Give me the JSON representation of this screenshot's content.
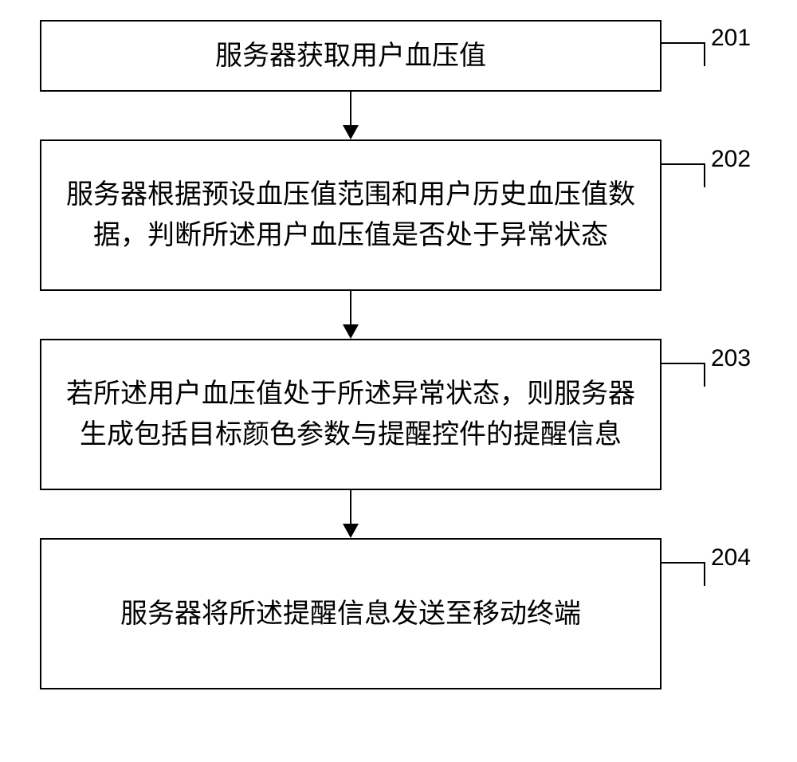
{
  "chart_data": {
    "type": "flowchart",
    "steps": [
      {
        "id": "201",
        "text": "服务器获取用户血压值",
        "size": "small"
      },
      {
        "id": "202",
        "text": "服务器根据预设血压值范围和用户历史血压值数据，判断所述用户血压值是否处于异常状态",
        "size": "large"
      },
      {
        "id": "203",
        "text": "若所述用户血压值处于所述异常状态，则服务器生成包括目标颜色参数与提醒控件的提醒信息",
        "size": "large"
      },
      {
        "id": "204",
        "text": "服务器将所述提醒信息发送至移动终端",
        "size": "large"
      }
    ]
  }
}
